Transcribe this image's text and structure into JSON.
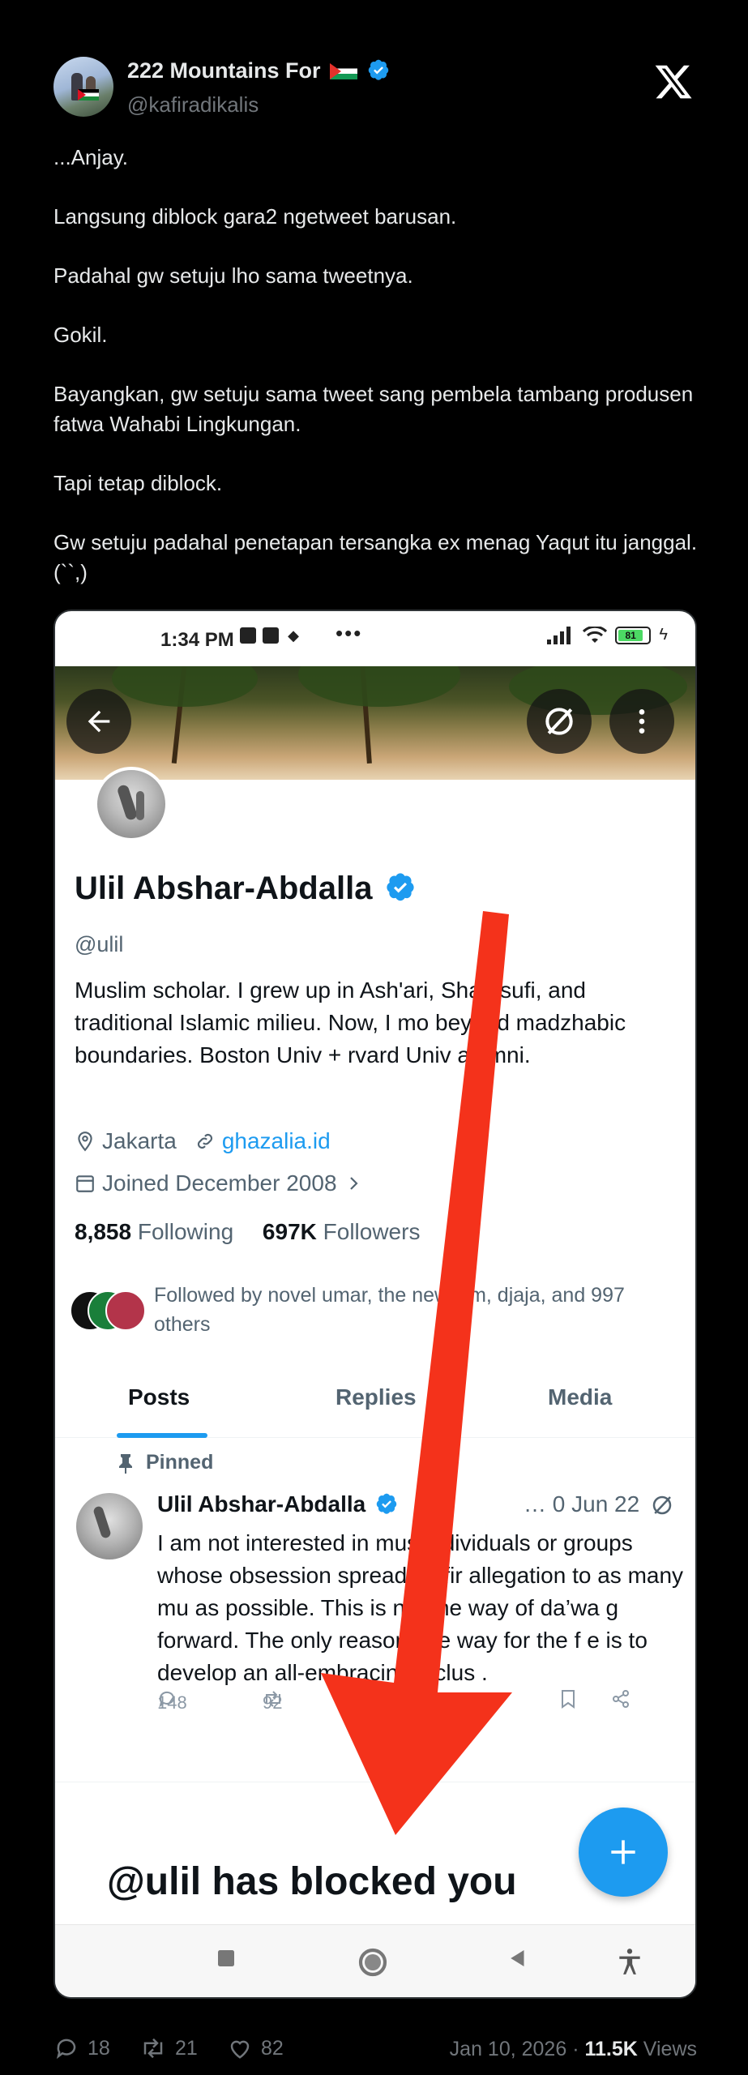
{
  "author": {
    "name": "222 Mountains For",
    "handle": "@kafiradikalis"
  },
  "tweet": {
    "paragraphs": [
      "...Anjay.",
      "Langsung diblock gara2 ngetweet barusan.",
      "Padahal gw setuju lho sama tweetnya.",
      "Gokil.",
      "Bayangkan, gw setuju sama tweet sang pembela tambang produsen fatwa Wahabi Lingkungan.",
      "Tapi tetap diblock.",
      "Gw setuju padahal penetapan tersangka ex menag Yaqut itu janggal. (``,)"
    ]
  },
  "screenshot": {
    "status_bar": {
      "time": "1:34 PM",
      "battery": "81"
    },
    "profile": {
      "name": "Ulil Abshar-Abdalla",
      "handle": "@ulil",
      "bio": "Muslim scholar. I grew up in Ash'ari, Sha    , sufi, and traditional Islamic milieu. Now, I mo    beyond madzhabic boundaries. Boston Univ +  rvard Univ alumni.",
      "location": "Jakarta",
      "website": "ghazalia.id",
      "joined": "Joined December 2008",
      "following_count": "8,858",
      "following_label": "Following",
      "followers_count": "697K",
      "followers_label": "Followers",
      "followed_by": "Followed by novel umar, the new     zim, djaja, and 997 others"
    },
    "tabs": [
      "Posts",
      "Replies",
      "Media"
    ],
    "pinned_label": "Pinned",
    "post": {
      "author": "Ulil Abshar-Abdalla",
      "meta": "…  0 Jun 22",
      "body": "I am not interested in mus    individuals or groups whose obsession    spread takfir allegation to as many mu     as possible. This is not the way of da’wa g    forward. The only reasonable way for the f     e is to develop an all-embracing inclus         .",
      "replies": "148",
      "reposts": "92"
    },
    "blocked_message": "@ulil has blocked you"
  },
  "footer": {
    "replies": "18",
    "reposts": "21",
    "likes": "82",
    "date": "Jan 10, 2026",
    "separator": " · ",
    "views_count": "11.5K",
    "views_label": " Views"
  },
  "colors": {
    "background": "#000000",
    "accent": "#1d9bf0",
    "arrow": "#f4321b",
    "muted": "#71767b"
  }
}
